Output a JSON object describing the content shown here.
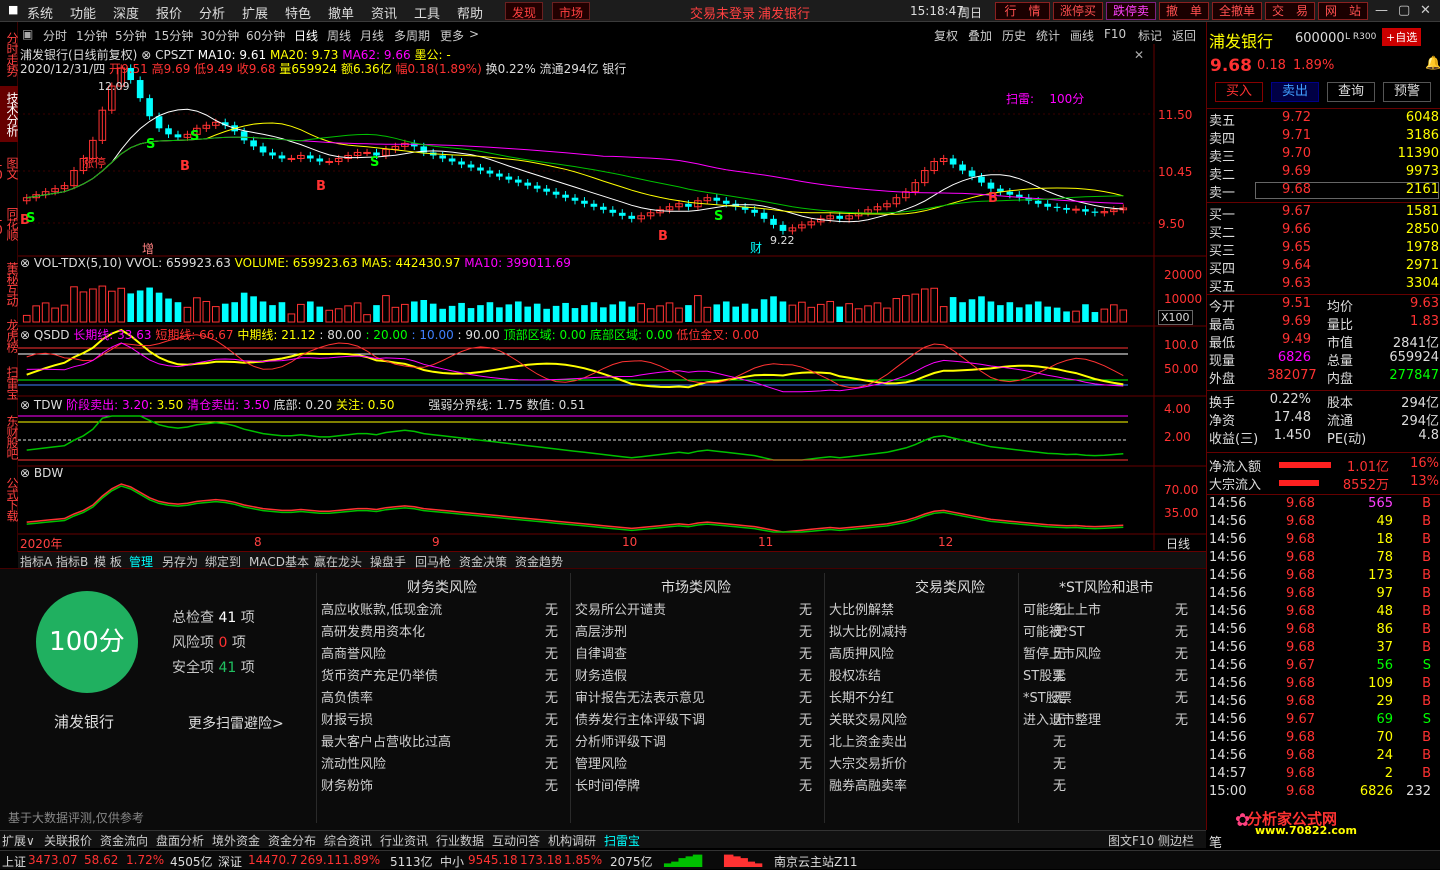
{
  "menu": [
    "系统",
    "功能",
    "深度",
    "报价",
    "分析",
    "扩展",
    "特色",
    "撤单",
    "资讯",
    "工具",
    "帮助"
  ],
  "menu_red": [
    "发现",
    "市场"
  ],
  "header": {
    "login": "交易未登录",
    "stock": "浦发银行",
    "time": "15:18:47",
    "weekday": "周日",
    "buttons": [
      "行　情",
      "涨停买",
      "跌停卖",
      "撤　单",
      "全撤单",
      "交　易",
      "网　站"
    ]
  },
  "left_tabs": [
    "分时走势",
    "技术分析",
    "图文10",
    "同花顺10",
    "董秘互动",
    "龙虎榜",
    "扫雷宝",
    "东财股吧",
    "公式下载"
  ],
  "toolbar": {
    "periods": [
      "分时",
      "1分钟",
      "5分钟",
      "15分钟",
      "30分钟",
      "60分钟",
      "日线",
      "周线",
      "月线",
      "多周期",
      "更多"
    ],
    "right": [
      "复权",
      "叠加",
      "历史",
      "统计",
      "画线",
      "F10",
      "标记",
      "返回"
    ]
  },
  "chart_data": {
    "type": "candlestick",
    "title": "浦发银行(日线前复权)",
    "indicators": {
      "CPSZT": "",
      "MA10": "9.61",
      "MA20": "9.73",
      "MA62": "9.66",
      "墨公": "-"
    },
    "info": {
      "date": "2020/12/31/四",
      "open_label": "开",
      "open": "9.51",
      "high_label": "高",
      "high": "9.69",
      "low_label": "低",
      "low": "9.49",
      "close_label": "收",
      "close": "9.68",
      "vol_label": "量",
      "vol": "659924",
      "amt_label": "额",
      "amt": "6.36亿",
      "chg_label": "幅",
      "chg": "0.18(1.89%)",
      "turn_label": "换",
      "turn": "0.22%",
      "float_label": "流通",
      "float": "294亿",
      "sector": "银行"
    },
    "price_axis": [
      "11.50",
      "10.45",
      "9.50"
    ],
    "price_range": [
      9.0,
      11.9
    ],
    "high_mark": "12.09",
    "low_mark": "9.22",
    "scan_label": "扫雷:",
    "scan_value": "100分",
    "signals": [
      "B",
      "S",
      "B",
      "S",
      "B",
      "S",
      "B",
      "S",
      "B",
      "S"
    ],
    "marks": [
      "增",
      "涨停",
      "财"
    ],
    "closes": [
      9.85,
      9.9,
      9.95,
      10.0,
      10.05,
      10.3,
      10.5,
      10.8,
      11.3,
      11.7,
      12.0,
      11.8,
      11.5,
      11.2,
      11.0,
      10.9,
      10.85,
      10.9,
      11.0,
      11.05,
      11.1,
      11.05,
      10.95,
      10.8,
      10.7,
      10.6,
      10.55,
      10.5,
      10.5,
      10.55,
      10.5,
      10.45,
      10.45,
      10.5,
      10.55,
      10.6,
      10.6,
      10.55,
      10.65,
      10.7,
      10.75,
      10.7,
      10.6,
      10.55,
      10.5,
      10.45,
      10.4,
      10.35,
      10.3,
      10.25,
      10.2,
      10.15,
      10.1,
      10.05,
      10.0,
      9.95,
      9.9,
      9.85,
      9.8,
      9.75,
      9.7,
      9.65,
      9.6,
      9.55,
      9.5,
      9.55,
      9.6,
      9.65,
      9.7,
      9.75,
      9.7,
      9.8,
      9.85,
      9.8,
      9.75,
      9.7,
      9.65,
      9.6,
      9.5,
      9.4,
      9.3,
      9.35,
      9.4,
      9.45,
      9.5,
      9.55,
      9.5,
      9.55,
      9.6,
      9.65,
      9.7,
      9.75,
      9.85,
      9.95,
      10.1,
      10.3,
      10.45,
      10.5,
      10.4,
      10.3,
      10.2,
      10.1,
      10.0,
      9.95,
      9.9,
      9.85,
      9.8,
      9.75,
      9.7,
      9.68,
      9.65,
      9.66,
      9.62,
      9.6,
      9.62,
      9.65,
      9.68
    ],
    "volume": {
      "label": "VOL-TDX(5,10)",
      "vvol": "VVOL: 659923.63",
      "volume": "VOLUME: 659923.63",
      "ma5": "MA5: 442430.97",
      "ma10": "MA10: 399011.69",
      "axis": [
        "20000",
        "10000",
        "X100"
      ]
    },
    "qsdd": {
      "label": "QSDD",
      "long": "长期线: 33.63",
      "short": "短期线: 66.67",
      "mid": "中期线: 21.12",
      "l80": ": 80.00",
      "l20": ": 20.00",
      "l10": ": 10.00",
      "l90": ": 90.00",
      "top": "顶部区域: 0.00",
      "bottom": "底部区域: 0.00",
      "low": "低位金叉: 0.00",
      "axis": [
        "100.0",
        "50.00"
      ]
    },
    "tdw": {
      "label": "TDW",
      "sell": "阶段卖出: 3.20",
      "sell2": ": 3.50",
      "clear": "清仓卖出: 3.50",
      "bottom": "底部: 0.20",
      "focus": "关注: 0.50",
      "line": "强弱分界线: 1.75",
      "val": "数值: 0.51",
      "axis": [
        "4.00",
        "2.00"
      ]
    },
    "bdw": {
      "label": "BDW",
      "axis": [
        "70.00",
        "35.00"
      ]
    },
    "dates": [
      "2020年",
      "8",
      "9",
      "10",
      "11",
      "12"
    ],
    "period": "日线"
  },
  "bottom_tabs": [
    "指标A",
    "指标B",
    "模 板",
    "管理",
    "另存为",
    "绑定到",
    "MACD基本",
    "赢在龙头",
    "操盘手",
    "回马枪",
    "资金决策",
    "资金趋势"
  ],
  "scan": {
    "score": "100分",
    "stock": "浦发银行",
    "total_label": "总检查",
    "total": "41",
    "risk_label": "风险项",
    "risk": "0",
    "safe_label": "安全项",
    "safe": "41",
    "unit": "项",
    "more": "更多扫雷避险>",
    "footnote": "基于大数据评测,仅供参考",
    "cols": [
      {
        "title": "财务类风险",
        "items": [
          "高应收账款,低现金流",
          "高研发费用资本化",
          "高商誉风险",
          "货币资产充足仍举债",
          "高负债率",
          "财报亏损",
          "最大客户占营收比过高",
          "流动性风险",
          "财务粉饰"
        ]
      },
      {
        "title": "市场类风险",
        "items": [
          "交易所公开谴责",
          "高层涉刑",
          "自律调查",
          "财务造假",
          "审计报告无法表示意见",
          "债券发行主体评级下调",
          "分析师评级下调",
          "管理风险",
          "长时间停牌"
        ]
      },
      {
        "title": "交易类风险",
        "items": [
          "大比例解禁",
          "拟大比例减持",
          "高质押风险",
          "股权冻结",
          "长期不分红",
          "关联交易风险",
          "北上资金卖出",
          "大宗交易折价",
          "融券高融卖率"
        ]
      },
      {
        "title": "*ST风险和退市",
        "items": [
          "可能终止上市",
          "可能被*ST",
          "暂停上市风险",
          "ST股票",
          "*ST股票",
          "进入退市整理"
        ]
      }
    ],
    "none": "无"
  },
  "right": {
    "name": "浦发银行",
    "code": "600000",
    "tag": "L R300",
    "add": "+自选",
    "price": "9.68",
    "chg": "0.18",
    "pct": "1.89%",
    "btns": [
      "买入",
      "卖出",
      "查询",
      "预警"
    ],
    "asks": [
      [
        "卖五",
        "9.72",
        "6048"
      ],
      [
        "卖四",
        "9.71",
        "3186"
      ],
      [
        "卖三",
        "9.70",
        "11390"
      ],
      [
        "卖二",
        "9.69",
        "9973"
      ],
      [
        "卖一",
        "9.68",
        "2161"
      ]
    ],
    "bids": [
      [
        "买一",
        "9.67",
        "1581"
      ],
      [
        "买二",
        "9.66",
        "2850"
      ],
      [
        "买三",
        "9.65",
        "1978"
      ],
      [
        "买四",
        "9.64",
        "2971"
      ],
      [
        "买五",
        "9.63",
        "3304"
      ]
    ],
    "stats": [
      [
        "今开",
        "9.51",
        "均价",
        "9.63"
      ],
      [
        "最高",
        "9.69",
        "量比",
        "1.83"
      ],
      [
        "最低",
        "9.49",
        "市值",
        "2841亿"
      ],
      [
        "现量",
        "6826",
        "总量",
        "659924"
      ],
      [
        "外盘",
        "382077",
        "内盘",
        "277847"
      ]
    ],
    "stats2": [
      [
        "换手",
        "0.22%",
        "股本",
        "294亿"
      ],
      [
        "净资",
        "17.48",
        "流通",
        "294亿"
      ],
      [
        "收益(三)",
        "1.450",
        "PE(动)",
        "4.8"
      ]
    ],
    "flow": [
      [
        "净流入额",
        "1.01亿",
        "16%"
      ],
      [
        "大宗流入",
        "8552万",
        "13%"
      ]
    ],
    "ticks": [
      [
        "14:56",
        "9.68",
        "565",
        "B"
      ],
      [
        "14:56",
        "9.68",
        "49",
        "B"
      ],
      [
        "14:56",
        "9.68",
        "18",
        "B"
      ],
      [
        "14:56",
        "9.68",
        "78",
        "B"
      ],
      [
        "14:56",
        "9.68",
        "173",
        "B"
      ],
      [
        "14:56",
        "9.68",
        "97",
        "B"
      ],
      [
        "14:56",
        "9.68",
        "48",
        "B"
      ],
      [
        "14:56",
        "9.68",
        "86",
        "B"
      ],
      [
        "14:56",
        "9.68",
        "37",
        "B"
      ],
      [
        "14:56",
        "9.67",
        "56",
        "S"
      ],
      [
        "14:56",
        "9.68",
        "109",
        "B"
      ],
      [
        "14:56",
        "9.68",
        "29",
        "B"
      ],
      [
        "14:56",
        "9.67",
        "69",
        "S"
      ],
      [
        "14:56",
        "9.68",
        "70",
        "B"
      ],
      [
        "14:56",
        "9.68",
        "24",
        "B"
      ],
      [
        "14:57",
        "9.68",
        "2",
        "B"
      ],
      [
        "15:00",
        "9.68",
        "6826",
        "232"
      ]
    ],
    "logo": "分析家公式网",
    "site": "www.70822.com",
    "side": "笔"
  },
  "bottom_bar": [
    "扩展∨",
    "关联报价",
    "资金流向",
    "盘面分析",
    "境外资金",
    "资金分布",
    "综合资讯",
    "行业资讯",
    "行业数据",
    "互动问答",
    "机构调研",
    "扫雷宝"
  ],
  "bottom_right": [
    "图文F10",
    "侧边栏"
  ],
  "status": {
    "sh_label": "上证",
    "sh": "3473.07",
    "sh_chg": "58.62",
    "sh_pct": "1.72%",
    "sh_amt": "4505亿",
    "sz_label": "深证",
    "sz": "14470.7",
    "sz_chg": "269.11",
    "sz_pct": "1.89%",
    "sz_amt": "5113亿",
    "zx_label": "中小",
    "zx": "9545.18",
    "zx_chg": "173.18",
    "zx_pct": "1.85%",
    "zx_amt": "2075亿",
    "server": "南京云主站Z11"
  },
  "colors": {
    "up": "#ff3232",
    "down": "#00ffff",
    "ma10": "#ffffff",
    "ma20": "#ffff00",
    "ma62": "#ff00ff",
    "green": "#00c000"
  }
}
